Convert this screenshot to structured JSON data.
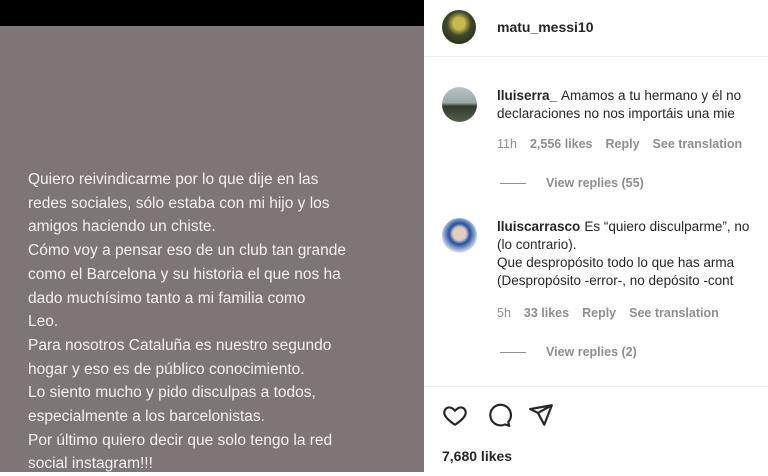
{
  "story": {
    "text": "Quiero reivindicarme por lo que dije en las\nredes sociales, sólo estaba con mi hijo y los\namigos haciendo un chiste.\nCómo voy a pensar eso de un club tan grande\ncomo el Barcelona y su historia el que nos ha\ndado muchísimo tanto a mi familia como\nLeo.\nPara nosotros Cataluña es nuestro segundo\nhogar y eso es de público conocimiento.\nLo siento mucho y pido disculpas a todos,\nespecialmente a los barcelonistas.\nPor último quiero decir que solo tengo la red\nsocial instagram!!!"
  },
  "header": {
    "username": "matu_messi10"
  },
  "comments": [
    {
      "username": "lluiserra_",
      "line1": "Amamos a tu hermano y él no",
      "line2": "declaraciones no nos importáis una mie",
      "time": "11h",
      "likes": "2,556 likes",
      "reply": "Reply",
      "translate": "See translation",
      "view_replies": "View replies (55)"
    },
    {
      "username": "lluiscarrasco",
      "line1": "Es “quiero disculparme”, no",
      "line2": "(lo contrario).",
      "line3": "Que despropósito todo lo que has arma",
      "line4": "(Despropósito -error-, no depósito -cont",
      "time": "5h",
      "likes": "33 likes",
      "reply": "Reply",
      "translate": "See translation",
      "view_replies": "View replies (2)"
    }
  ],
  "footer": {
    "icons": [
      "heart-icon",
      "comment-icon",
      "share-icon"
    ],
    "likes": "7,680 likes"
  }
}
